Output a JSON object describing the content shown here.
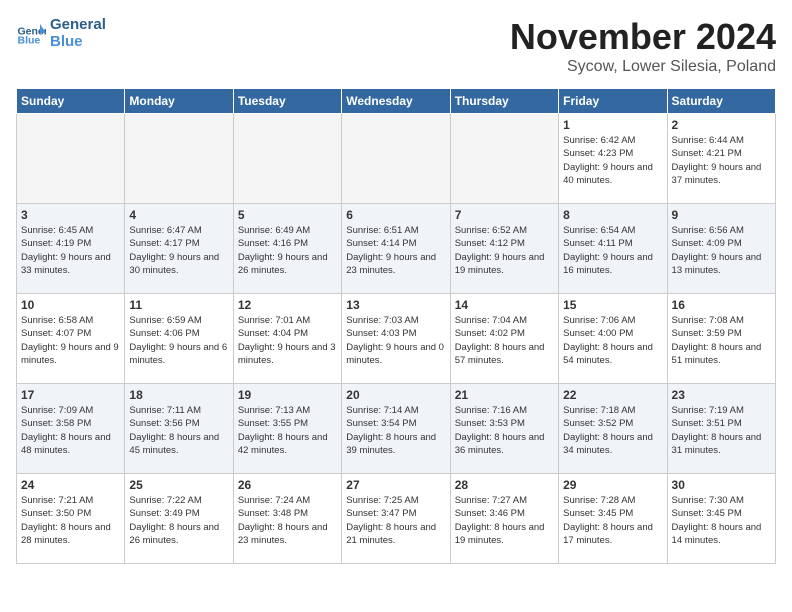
{
  "logo": {
    "text_general": "General",
    "text_blue": "Blue"
  },
  "header": {
    "month": "November 2024",
    "location": "Sycow, Lower Silesia, Poland"
  },
  "weekdays": [
    "Sunday",
    "Monday",
    "Tuesday",
    "Wednesday",
    "Thursday",
    "Friday",
    "Saturday"
  ],
  "weeks": [
    [
      {
        "day": "",
        "info": "",
        "empty": true
      },
      {
        "day": "",
        "info": "",
        "empty": true
      },
      {
        "day": "",
        "info": "",
        "empty": true
      },
      {
        "day": "",
        "info": "",
        "empty": true
      },
      {
        "day": "",
        "info": "",
        "empty": true
      },
      {
        "day": "1",
        "info": "Sunrise: 6:42 AM\nSunset: 4:23 PM\nDaylight: 9 hours\nand 40 minutes."
      },
      {
        "day": "2",
        "info": "Sunrise: 6:44 AM\nSunset: 4:21 PM\nDaylight: 9 hours\nand 37 minutes."
      }
    ],
    [
      {
        "day": "3",
        "info": "Sunrise: 6:45 AM\nSunset: 4:19 PM\nDaylight: 9 hours\nand 33 minutes."
      },
      {
        "day": "4",
        "info": "Sunrise: 6:47 AM\nSunset: 4:17 PM\nDaylight: 9 hours\nand 30 minutes."
      },
      {
        "day": "5",
        "info": "Sunrise: 6:49 AM\nSunset: 4:16 PM\nDaylight: 9 hours\nand 26 minutes."
      },
      {
        "day": "6",
        "info": "Sunrise: 6:51 AM\nSunset: 4:14 PM\nDaylight: 9 hours\nand 23 minutes."
      },
      {
        "day": "7",
        "info": "Sunrise: 6:52 AM\nSunset: 4:12 PM\nDaylight: 9 hours\nand 19 minutes."
      },
      {
        "day": "8",
        "info": "Sunrise: 6:54 AM\nSunset: 4:11 PM\nDaylight: 9 hours\nand 16 minutes."
      },
      {
        "day": "9",
        "info": "Sunrise: 6:56 AM\nSunset: 4:09 PM\nDaylight: 9 hours\nand 13 minutes."
      }
    ],
    [
      {
        "day": "10",
        "info": "Sunrise: 6:58 AM\nSunset: 4:07 PM\nDaylight: 9 hours\nand 9 minutes."
      },
      {
        "day": "11",
        "info": "Sunrise: 6:59 AM\nSunset: 4:06 PM\nDaylight: 9 hours\nand 6 minutes."
      },
      {
        "day": "12",
        "info": "Sunrise: 7:01 AM\nSunset: 4:04 PM\nDaylight: 9 hours\nand 3 minutes."
      },
      {
        "day": "13",
        "info": "Sunrise: 7:03 AM\nSunset: 4:03 PM\nDaylight: 9 hours\nand 0 minutes."
      },
      {
        "day": "14",
        "info": "Sunrise: 7:04 AM\nSunset: 4:02 PM\nDaylight: 8 hours\nand 57 minutes."
      },
      {
        "day": "15",
        "info": "Sunrise: 7:06 AM\nSunset: 4:00 PM\nDaylight: 8 hours\nand 54 minutes."
      },
      {
        "day": "16",
        "info": "Sunrise: 7:08 AM\nSunset: 3:59 PM\nDaylight: 8 hours\nand 51 minutes."
      }
    ],
    [
      {
        "day": "17",
        "info": "Sunrise: 7:09 AM\nSunset: 3:58 PM\nDaylight: 8 hours\nand 48 minutes."
      },
      {
        "day": "18",
        "info": "Sunrise: 7:11 AM\nSunset: 3:56 PM\nDaylight: 8 hours\nand 45 minutes."
      },
      {
        "day": "19",
        "info": "Sunrise: 7:13 AM\nSunset: 3:55 PM\nDaylight: 8 hours\nand 42 minutes."
      },
      {
        "day": "20",
        "info": "Sunrise: 7:14 AM\nSunset: 3:54 PM\nDaylight: 8 hours\nand 39 minutes."
      },
      {
        "day": "21",
        "info": "Sunrise: 7:16 AM\nSunset: 3:53 PM\nDaylight: 8 hours\nand 36 minutes."
      },
      {
        "day": "22",
        "info": "Sunrise: 7:18 AM\nSunset: 3:52 PM\nDaylight: 8 hours\nand 34 minutes."
      },
      {
        "day": "23",
        "info": "Sunrise: 7:19 AM\nSunset: 3:51 PM\nDaylight: 8 hours\nand 31 minutes."
      }
    ],
    [
      {
        "day": "24",
        "info": "Sunrise: 7:21 AM\nSunset: 3:50 PM\nDaylight: 8 hours\nand 28 minutes."
      },
      {
        "day": "25",
        "info": "Sunrise: 7:22 AM\nSunset: 3:49 PM\nDaylight: 8 hours\nand 26 minutes."
      },
      {
        "day": "26",
        "info": "Sunrise: 7:24 AM\nSunset: 3:48 PM\nDaylight: 8 hours\nand 23 minutes."
      },
      {
        "day": "27",
        "info": "Sunrise: 7:25 AM\nSunset: 3:47 PM\nDaylight: 8 hours\nand 21 minutes."
      },
      {
        "day": "28",
        "info": "Sunrise: 7:27 AM\nSunset: 3:46 PM\nDaylight: 8 hours\nand 19 minutes."
      },
      {
        "day": "29",
        "info": "Sunrise: 7:28 AM\nSunset: 3:45 PM\nDaylight: 8 hours\nand 17 minutes."
      },
      {
        "day": "30",
        "info": "Sunrise: 7:30 AM\nSunset: 3:45 PM\nDaylight: 8 hours\nand 14 minutes."
      }
    ]
  ]
}
